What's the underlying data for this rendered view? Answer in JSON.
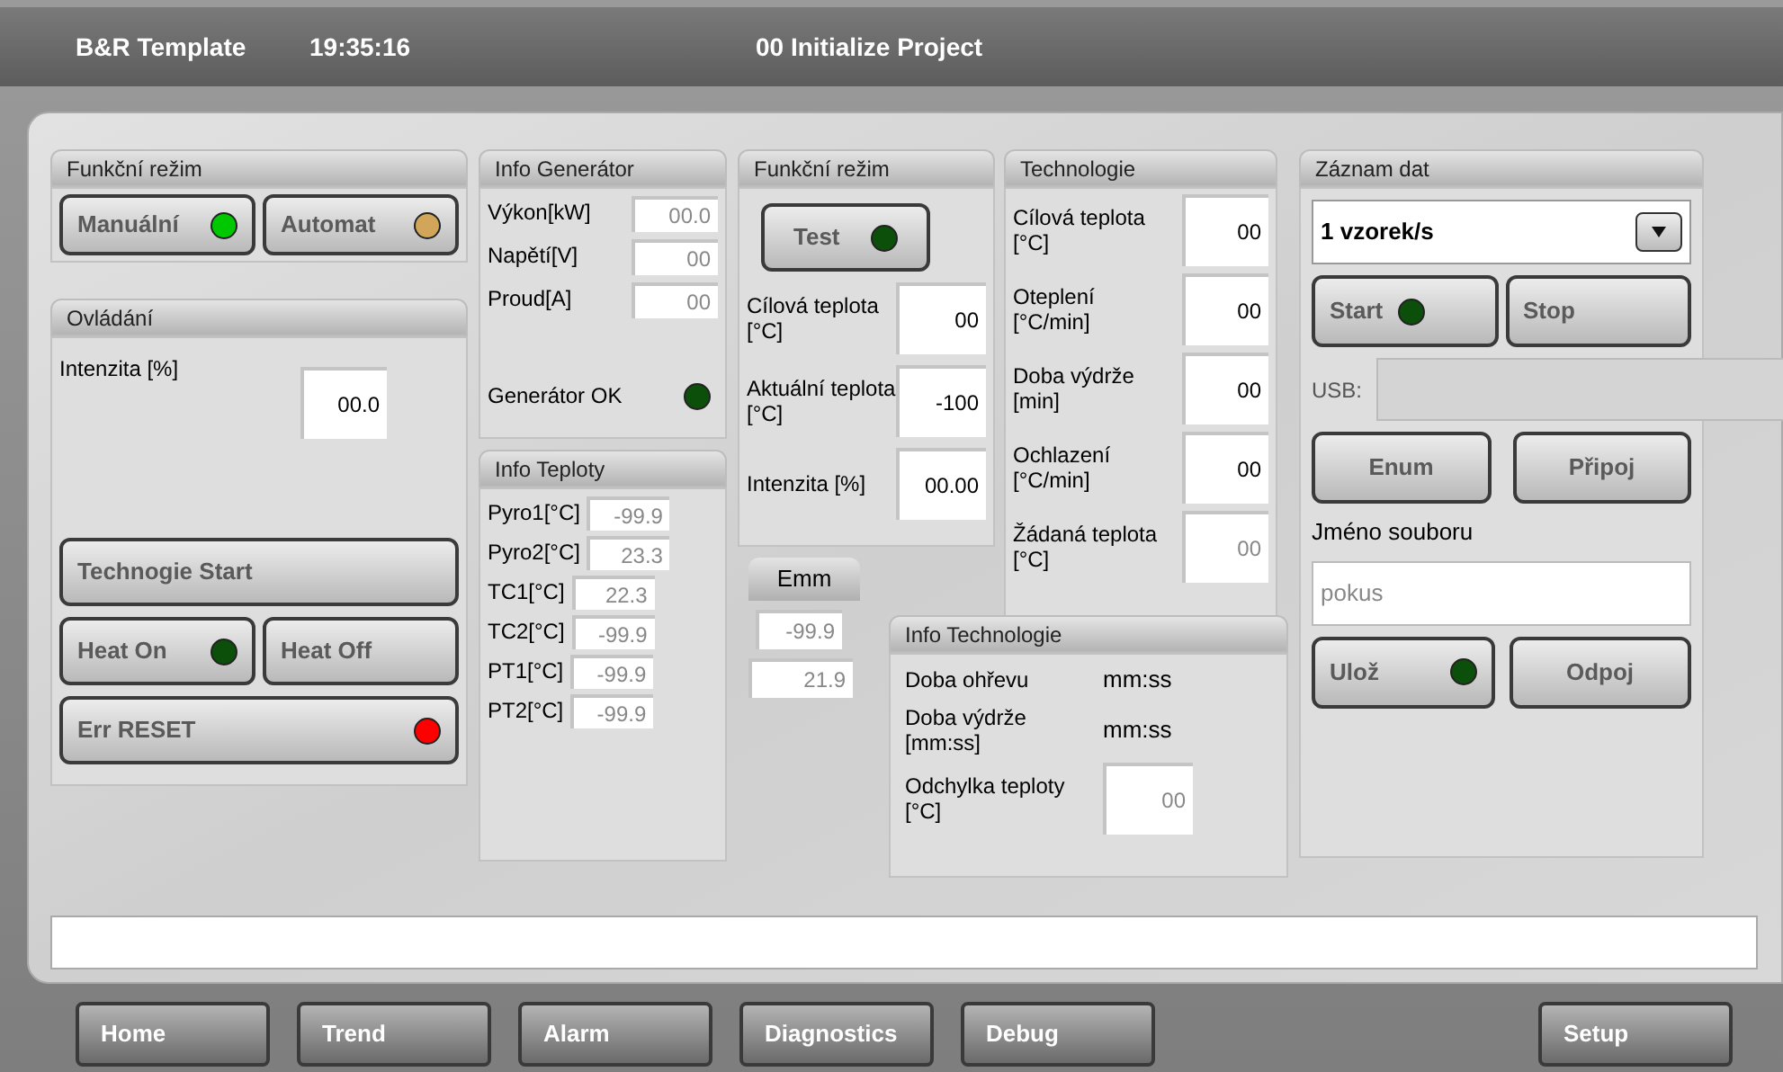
{
  "header": {
    "app_title": "B&R Template",
    "time": "19:35:16",
    "page_title": "00 Initialize Project"
  },
  "mode_panel": {
    "title": "Funkční režim",
    "buttons": [
      {
        "label": "Manuální",
        "color": "#00c800"
      },
      {
        "label": "Automat",
        "color": "#d2a65a"
      }
    ]
  },
  "control_panel": {
    "title": "Ovládání",
    "field": {
      "label": "Intenzita [%]",
      "value": "00.0",
      "readonly": false
    },
    "rows": [
      [
        {
          "label": "Technogie Start"
        }
      ],
      [
        {
          "label": "Heat On",
          "color": "#0b4f0b"
        },
        {
          "label": "Heat Off"
        }
      ],
      [
        {
          "label": "Err RESET",
          "color": "#ff0000"
        }
      ]
    ]
  },
  "generator_panel": {
    "title": "Info Generátor",
    "fields": [
      {
        "label": "Výkon[kW]",
        "value": "00.0",
        "readonly": true
      },
      {
        "label": "Napětí[V]",
        "value": "00",
        "readonly": true
      },
      {
        "label": "Proud[A]",
        "value": "00",
        "readonly": true
      }
    ],
    "status": {
      "label": "Generátor OK",
      "color": "#0b4f0b"
    }
  },
  "temperature_panel": {
    "title": "Info Teploty",
    "fields": [
      {
        "label": "Pyro1[°C]",
        "value": "-99.9",
        "readonly": true
      },
      {
        "label": "Pyro2[°C]",
        "value": "23.3",
        "readonly": true
      },
      {
        "label": "TC1[°C]",
        "value": "22.3",
        "readonly": true
      },
      {
        "label": "TC2[°C]",
        "value": "-99.9",
        "readonly": true
      },
      {
        "label": "PT1[°C]",
        "value": "-99.9",
        "readonly": true
      },
      {
        "label": "PT2[°C]",
        "value": "-99.9",
        "readonly": true
      }
    ]
  },
  "test_panel": {
    "title": "Funkční režim",
    "button": {
      "label": "Test",
      "color": "#0b4f0b"
    },
    "fields": [
      {
        "label": "Cílová teplota [°C]",
        "value": "00",
        "readonly": false
      },
      {
        "label": "Aktuální teplota [°C]",
        "value": "-100",
        "readonly": false
      },
      {
        "label": "Intenzita [%]",
        "value": "00.00",
        "readonly": false
      }
    ]
  },
  "technology_panel": {
    "title": "Technologie",
    "fields": [
      {
        "label": "Cílová teplota [°C]",
        "value": "00",
        "readonly": false
      },
      {
        "label": "Oteplení [°C/min]",
        "value": "00",
        "readonly": false
      },
      {
        "label": "Doba výdrže [min]",
        "value": "00",
        "readonly": false
      },
      {
        "label": "Ochlazení [°C/min]",
        "value": "00",
        "readonly": false
      },
      {
        "label": "Žádaná teplota [°C]",
        "value": "00",
        "readonly": true
      }
    ]
  },
  "emm_panel": {
    "title": "Emm",
    "values": [
      {
        "value": "-99.9",
        "readonly": true
      },
      {
        "value": "21.9",
        "readonly": true
      }
    ]
  },
  "technology_info_panel": {
    "title": "Info Technologie",
    "rows": [
      {
        "kind": "text",
        "label": "Doba ohřevu",
        "value": "mm:ss"
      },
      {
        "kind": "text",
        "label": "Doba výdrže [mm:ss]",
        "value": "mm:ss"
      },
      {
        "kind": "field",
        "label": "Odchylka teploty [°C]",
        "value": "00",
        "readonly": true
      }
    ]
  },
  "logging_panel": {
    "title": "Záznam dat",
    "dropdown": {
      "value": "1 vzorek/s"
    },
    "rows": [
      [
        {
          "label": "Start",
          "color": "#0b4f0b"
        },
        {
          "label": "Stop"
        }
      ]
    ],
    "usb": {
      "label": "USB:"
    },
    "usb_rows": [
      [
        {
          "label": "Enum"
        },
        {
          "label": "Připoj"
        }
      ]
    ],
    "filename": {
      "label": "Jméno souboru",
      "value": "pokus",
      "readonly": true
    },
    "file_rows": [
      [
        {
          "label": "Ulož",
          "color": "#0b4f0b"
        },
        {
          "label": "Odpoj"
        }
      ]
    ]
  },
  "nav": {
    "left": [
      "Home",
      "Trend",
      "Alarm",
      "Diagnostics",
      "Debug"
    ],
    "right": [
      "Setup"
    ]
  }
}
